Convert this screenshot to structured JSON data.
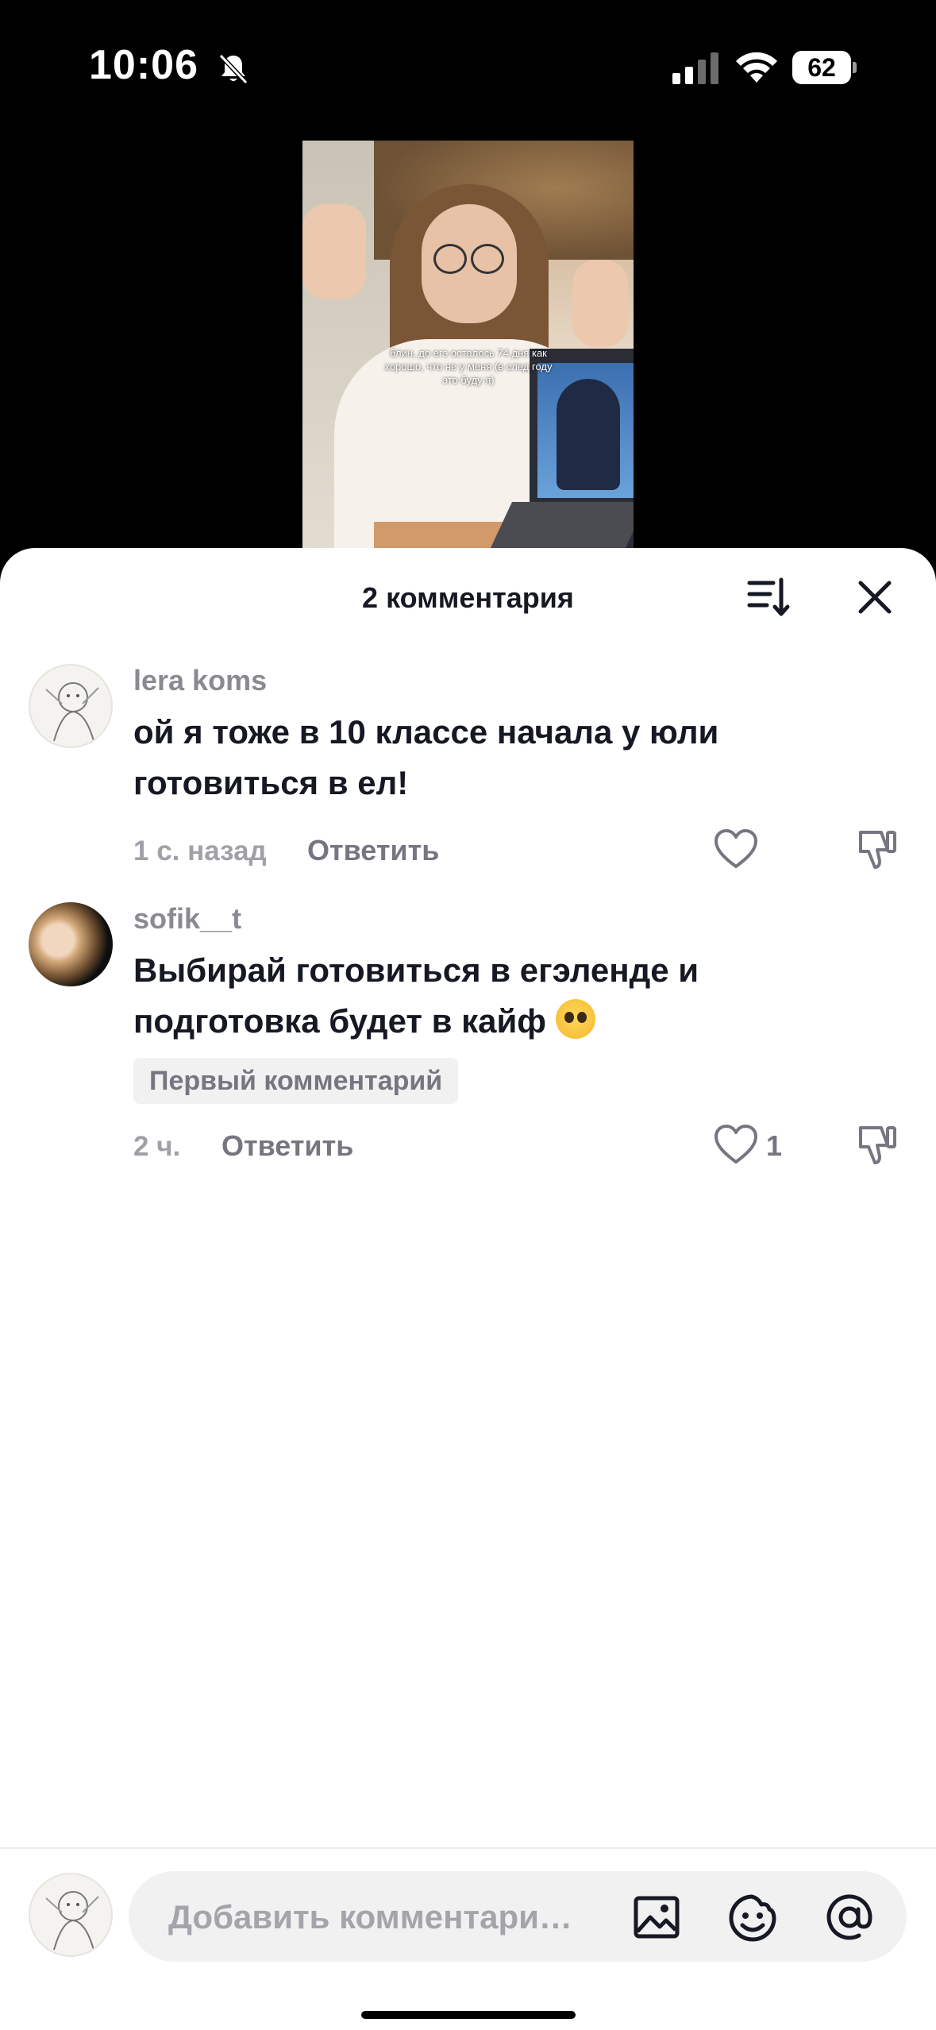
{
  "status_bar": {
    "time": "10:06",
    "battery": "62",
    "icons": [
      "bell-slash-icon",
      "signal-icon",
      "wifi-icon",
      "battery-icon"
    ]
  },
  "video": {
    "caption": "блин, до егэ осталось 74 дня как хорошо, что не у меня (в след году это буду я)"
  },
  "sheet": {
    "title": "2 комментария",
    "icons": [
      "sort-icon",
      "close-icon"
    ]
  },
  "comments": [
    {
      "username": "lera koms",
      "text": "ой я тоже в 10 классе начала у юли готовиться в ел!",
      "time": "1 с. назад",
      "reply_label": "Ответить",
      "likes": ""
    },
    {
      "username": "sofik__t",
      "text": "Выбирай готовиться в егэленде и подготовка будет в кайф",
      "emoji": "pleading-face",
      "badge": "Первый комментарий",
      "time": "2 ч.",
      "reply_label": "Ответить",
      "likes": "1"
    }
  ],
  "composer": {
    "placeholder": "Добавить комментари…",
    "icons": [
      "image-icon",
      "emoji-icon",
      "at-icon"
    ]
  },
  "colors": {
    "text_primary": "#161823",
    "text_secondary": "#757680",
    "sheet_background": "#ffffff",
    "screen_background": "#000000"
  }
}
